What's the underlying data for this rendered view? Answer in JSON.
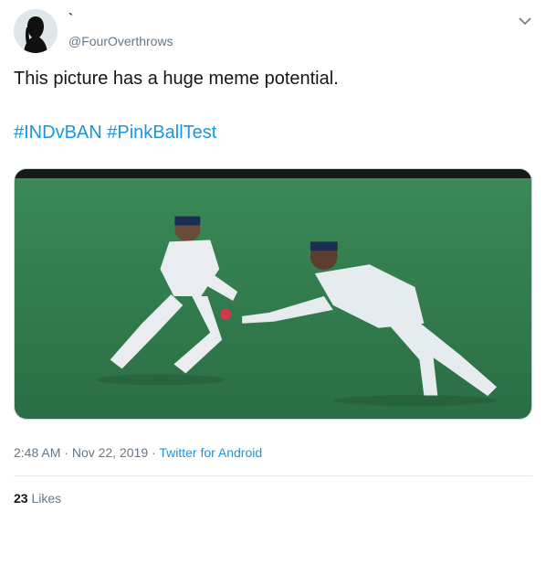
{
  "author": {
    "display_name": "`",
    "handle": "@FourOverthrows",
    "avatar_icon": "silhouette-avatar-icon"
  },
  "tweet": {
    "text": "This picture has a huge meme potential.",
    "hashtags": [
      "#INDvBAN",
      "#PinkBallTest"
    ],
    "media_description_icon": "photo-icon"
  },
  "meta": {
    "time": "2:48 AM",
    "separator": "·",
    "date": "Nov 22, 2019",
    "source": "Twitter for Android"
  },
  "stats": {
    "likes_count": "23",
    "likes_label": "Likes"
  },
  "colors": {
    "accent": "#1b95e0",
    "text": "#14171a",
    "secondary": "#657786",
    "field_green": "#2f7a4a"
  }
}
